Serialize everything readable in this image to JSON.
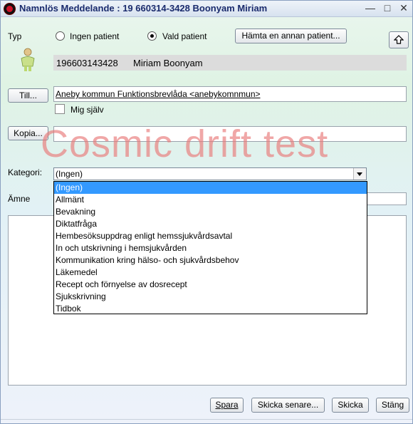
{
  "window": {
    "title": "Namnlös Meddelande :  19 660314-3428 Boonyam Miriam",
    "minimize_glyph": "—",
    "maximize_glyph": "□",
    "close_glyph": "✕"
  },
  "patient_type": {
    "label": "Typ",
    "options": [
      {
        "label": "Ingen patient",
        "selected": false
      },
      {
        "label": "Vald patient",
        "selected": true
      }
    ],
    "fetch_button": "Hämta en annan patient...",
    "up_button_icon": "arrow-up-icon"
  },
  "patient": {
    "id": "196603143428",
    "name": "Miriam Boonyam",
    "icon": "patient-person-icon"
  },
  "recipients": {
    "to_button": "Till...",
    "to_value": "Aneby kommun Funktionsbrevlåda <anebykomnmun>",
    "self_checkbox_label": "Mig själv",
    "self_checked": false,
    "copy_button": "Kopia...",
    "copy_value": ""
  },
  "watermark": "Cosmic drift test",
  "category": {
    "label": "Kategori:",
    "selected": "(Ingen)",
    "options": [
      "(Ingen)",
      "Allmänt",
      "Bevakning",
      "Diktatfråga",
      "Hembesöksuppdrag enligt hemssjukvårdsavtal",
      "In och utskrivning i hemsjukvården",
      "Kommunikation kring hälso- och sjukvårdsbehov",
      "Läkemedel",
      "Recept och förnyelse av dosrecept",
      "Sjukskrivning",
      "Tidbok"
    ]
  },
  "subject": {
    "label": "Ämne",
    "value": ""
  },
  "body": {
    "value": ""
  },
  "footer": {
    "save": "Spara",
    "send_later": "Skicka senare...",
    "send": "Skicka",
    "close": "Stäng"
  },
  "colors": {
    "selection": "#3399ff",
    "watermark": "#e87878",
    "title_text": "#1a2b6d"
  }
}
